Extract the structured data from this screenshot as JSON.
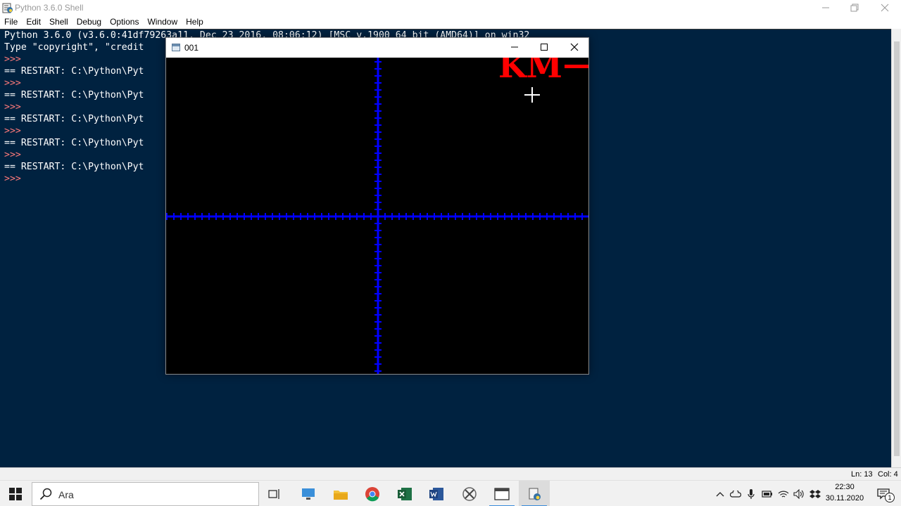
{
  "window": {
    "title": "Python 3.6.0 Shell"
  },
  "menu": [
    "File",
    "Edit",
    "Shell",
    "Debug",
    "Options",
    "Window",
    "Help"
  ],
  "shell": {
    "banner1": "Python 3.6.0 (v3.6.0:41df79263a11, Dec 23 2016, 08:06:12) [MSC v.1900 64 bit (AMD64)] on win32",
    "banner2": "Type \"copyright\", \"credit",
    "prompt": ">>>",
    "restart": "== RESTART: C:\\Python\\Pyt"
  },
  "status": {
    "line": "Ln: 13",
    "col": "Col: 4"
  },
  "turtle_window": {
    "title": "001",
    "drawn_text": "KM"
  },
  "colors": {
    "shell_bg": "#002240",
    "axis": "#0000ff",
    "drawing_red": "#ff0000",
    "prompt": "#ff7a7a"
  },
  "taskbar": {
    "search_placeholder": "Ara",
    "time": "22:30",
    "date": "30.11.2020",
    "notification_count": "1"
  }
}
